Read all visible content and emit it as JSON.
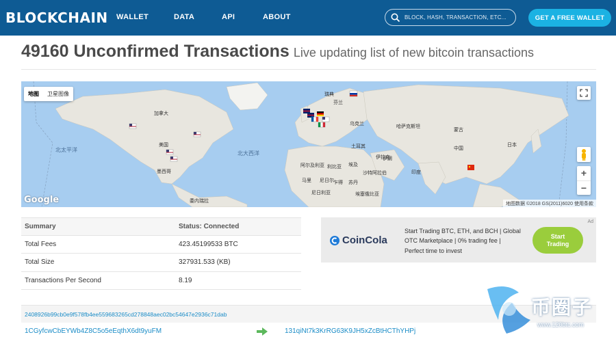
{
  "nav": {
    "brand": "BLOCKCHAIN",
    "links": [
      "WALLET",
      "DATA",
      "API",
      "ABOUT"
    ],
    "search_placeholder": "BLOCK, HASH, TRANSACTION, ETC...",
    "cta": "GET A FREE WALLET"
  },
  "heading": {
    "title": "49160 Unconfirmed Transactions",
    "subtitle": "Live updating list of new bitcoin transactions"
  },
  "map": {
    "type_options": [
      "地图",
      "卫星图像"
    ],
    "labels": {
      "canada": "加拿大",
      "usa": "美国",
      "mexico": "墨西哥",
      "north_pacific": "北太平洋",
      "north_atlantic": "北大西洋",
      "algeria": "阿尔及利亚",
      "libya": "利比亚",
      "egypt": "埃及",
      "mali": "马里",
      "niger": "尼日尔",
      "chad": "乍得",
      "sudan": "苏丹",
      "saudi": "沙特阿拉伯",
      "iran": "伊朗",
      "kazakhstan": "哈萨克斯坦",
      "mongolia": "蒙古",
      "china": "中国",
      "japan": "日本",
      "india": "印度",
      "ukraine": "乌克兰",
      "sweden": "瑞典",
      "iraq": "伊拉克",
      "ethiopia": "埃塞俄比亚",
      "venezuela": "委内瑞拉",
      "nigeria": "尼日利亚",
      "turkey": "土耳其",
      "finland": "芬兰"
    },
    "google": "Google",
    "attribution": "地图数据 ©2018 GS(2011)6020   使用条款",
    "zoom_in": "+",
    "zoom_out": "−"
  },
  "summary": {
    "header": [
      "Summary",
      "Status: Connected"
    ],
    "rows": [
      [
        "Total Fees",
        "423.45199533 BTC"
      ],
      [
        "Total Size",
        "327931.533 (KB)"
      ],
      [
        "Transactions Per Second",
        "8.19"
      ]
    ]
  },
  "ad": {
    "tag": "Ad",
    "brand": "CoinCola",
    "copy": "Start Trading BTC, ETH, and BCH | Global OTC Marketplace | 0% trading fee | Perfect time to invest",
    "cta": "Start Trading"
  },
  "transactions": {
    "hash": "2408926b99cb0e9f578fb4ee559683265cd278848aec02bc54647e2936c71dab",
    "from": "1CGyfcwCbEYWb4Z8C5o5eEqthX6dt9yuFM",
    "to": "131qiNt7k3KrRG63K9JH5xZcBtHCThYHPj"
  },
  "watermark": {
    "text": "币圈子",
    "url": "www.120btc.com"
  },
  "colors": {
    "navbar": "#0e5b94",
    "accent": "#1bb2e3",
    "link": "#1a8cc7",
    "ocean": "#a7cdf0",
    "land": "#e8e6df",
    "ad_cta": "#9acd3c"
  }
}
